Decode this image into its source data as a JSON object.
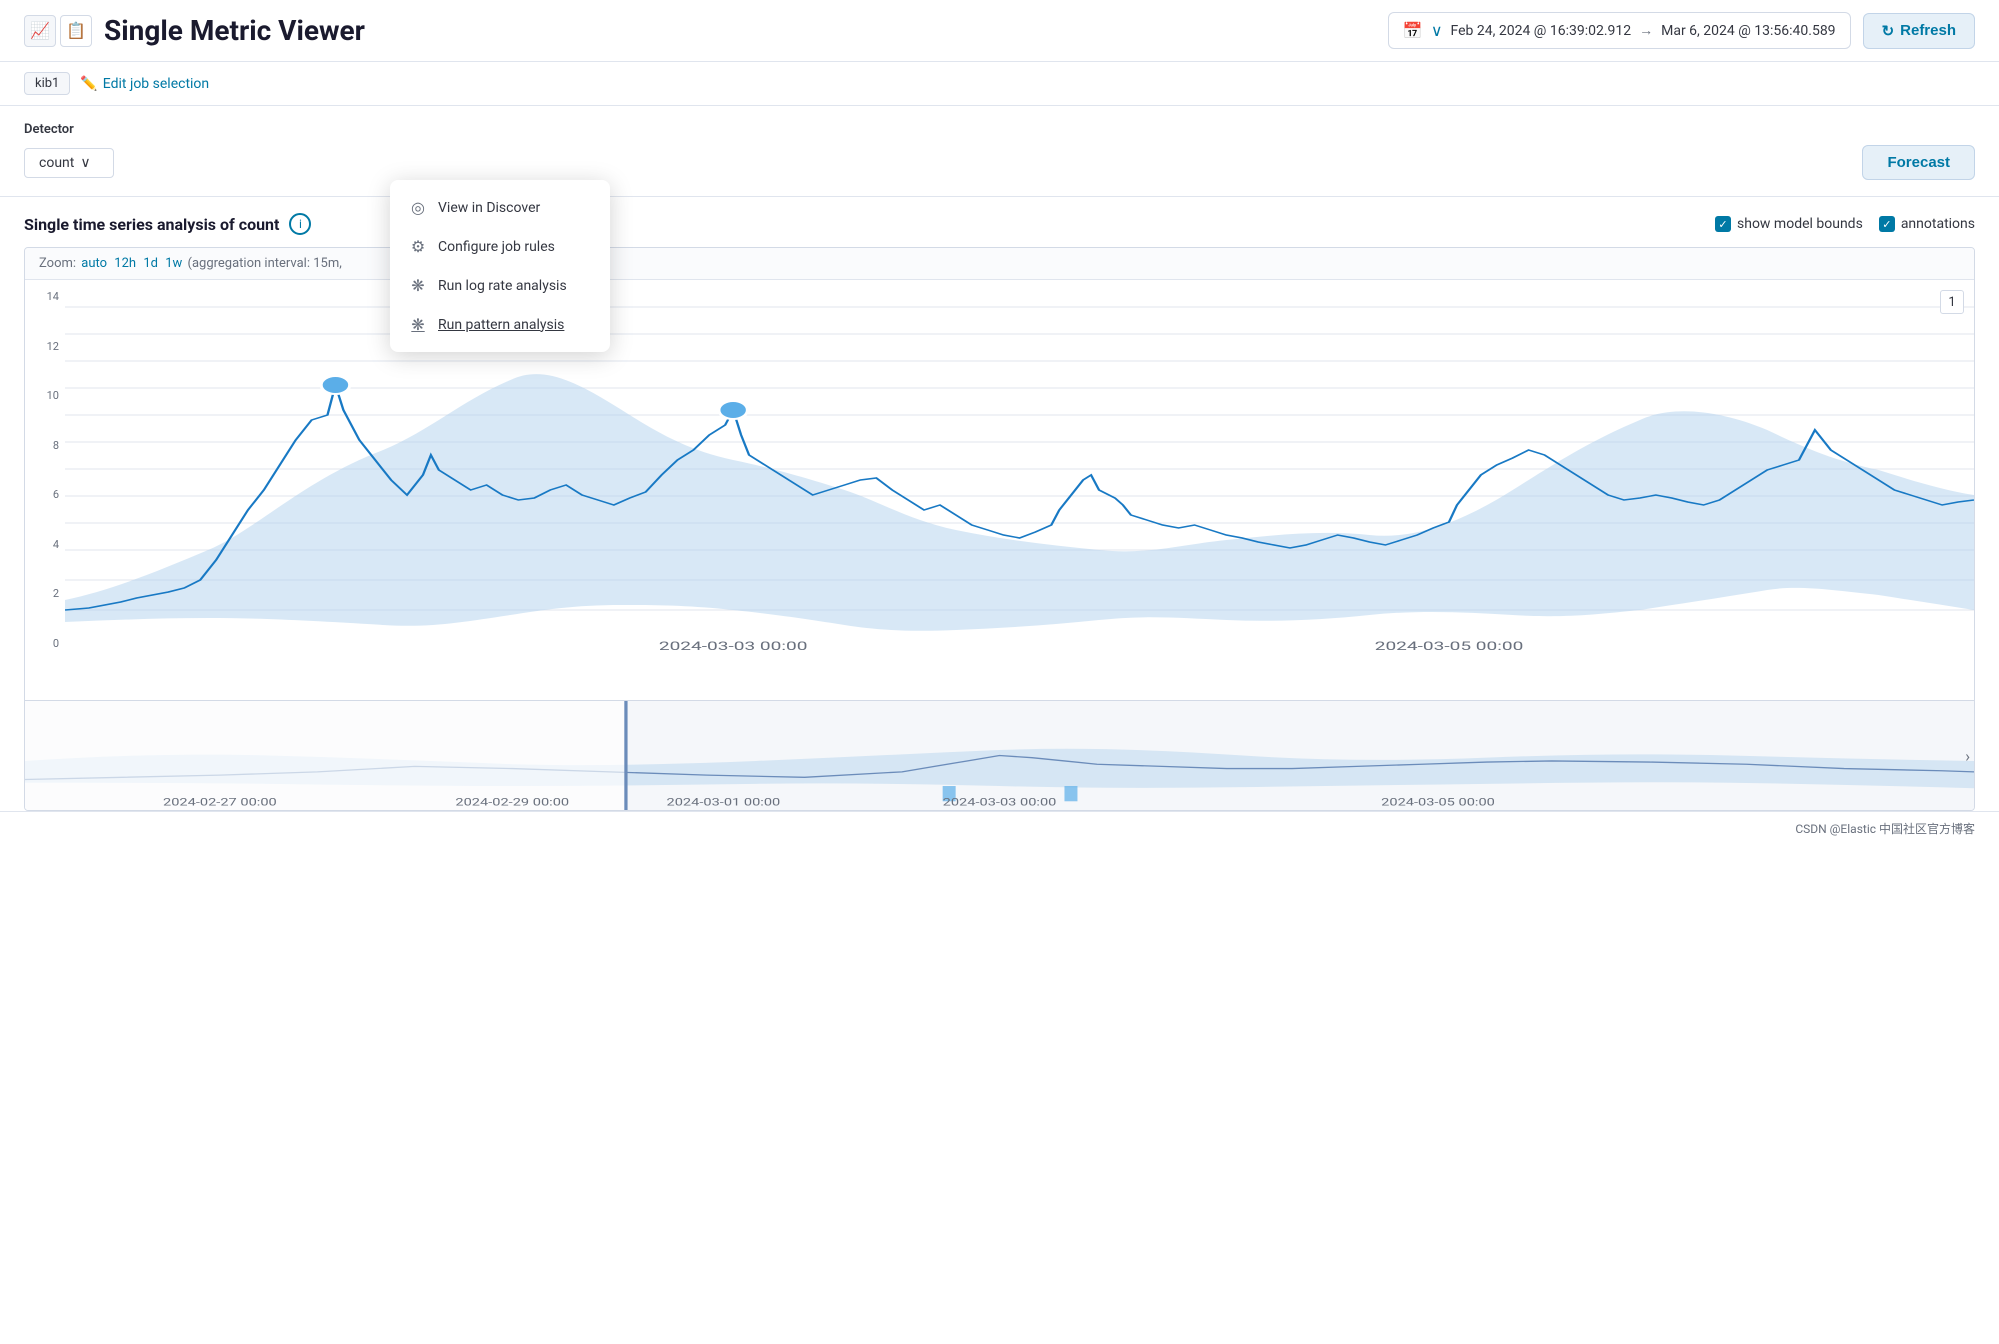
{
  "header": {
    "icon_chart": "📈",
    "icon_table": "📋",
    "title": "Single Metric Viewer",
    "date_from": "Feb 24, 2024 @ 16:39:02.912",
    "date_arrow": "→",
    "date_to": "Mar 6, 2024 @ 13:56:40.589",
    "refresh_label": "Refresh"
  },
  "breadcrumb": {
    "kib": "kib1",
    "edit_label": "Edit job selection"
  },
  "controls": {
    "detector_label": "Detector",
    "count_value": "count",
    "chevron": "∨",
    "forecast_label": "Forecast"
  },
  "analysis": {
    "title": "Single time series analysis of count",
    "info": "i",
    "show_model_bounds_label": "show model bounds",
    "annotations_label": "annotations"
  },
  "zoom": {
    "prefix": "Zoom:",
    "links": "auto 12h 1d 1w",
    "suffix": "(aggregation interval: 15m,"
  },
  "chart": {
    "y_labels": [
      "14",
      "12",
      "10",
      "8",
      "6",
      "4",
      "2",
      "0"
    ],
    "x_labels": [
      "2024-03-03 00:00",
      "2024-03-05 00:00"
    ],
    "badge": "1"
  },
  "minimap": {
    "x_labels": [
      "2024-02-27 00:00",
      "2024-02-29 00:00",
      "2024-03-01 00:00",
      "2024-03-03 00:00",
      "2024-03-05 00:00"
    ]
  },
  "context_menu": {
    "items": [
      {
        "icon": "◎",
        "label": "View in Discover"
      },
      {
        "icon": "⚙",
        "label": "Configure job rules"
      },
      {
        "icon": "❋",
        "label": "Run log rate analysis"
      },
      {
        "icon": "❋",
        "label": "Run pattern analysis",
        "underline": true
      }
    ]
  },
  "footer": {
    "text": "CSDN @Elastic 中国社区官方博客"
  }
}
